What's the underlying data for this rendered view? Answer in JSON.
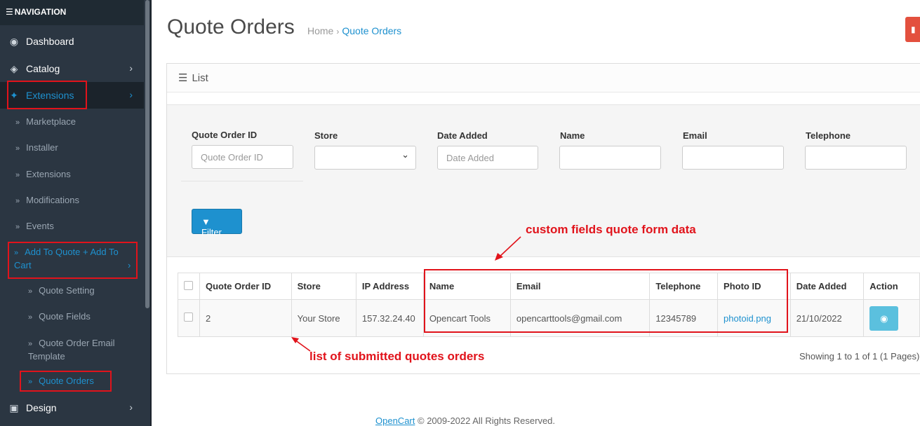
{
  "sidebar": {
    "header": "NAVIGATION",
    "items": [
      {
        "label": "Dashboard",
        "icon": "dashboard-icon"
      },
      {
        "label": "Catalog",
        "icon": "tags-icon"
      },
      {
        "label": "Extensions",
        "icon": "puzzle-icon"
      },
      {
        "label": "Design",
        "icon": "monitor-icon"
      }
    ],
    "extensions_sub": [
      "Marketplace",
      "Installer",
      "Extensions",
      "Modifications",
      "Events"
    ],
    "quote_group": "Add To Quote + Add To Cart",
    "quote_sub": [
      "Quote Setting",
      "Quote Fields",
      "Quote Order Email Template",
      "Quote Orders"
    ]
  },
  "header": {
    "title": "Quote Orders",
    "breadcrumb": [
      "Home",
      "Quote Orders"
    ]
  },
  "panel": {
    "title": "List"
  },
  "filters": {
    "quote_order_id": {
      "label": "Quote Order ID",
      "placeholder": "Quote Order ID"
    },
    "store": {
      "label": "Store",
      "value": ""
    },
    "date_added": {
      "label": "Date Added",
      "placeholder": "Date Added"
    },
    "name": {
      "label": "Name",
      "placeholder": ""
    },
    "email": {
      "label": "Email",
      "placeholder": ""
    },
    "telephone": {
      "label": "Telephone",
      "placeholder": ""
    },
    "button": "Filter"
  },
  "table": {
    "columns": [
      "Quote Order ID",
      "Store",
      "IP Address",
      "Name",
      "Email",
      "Telephone",
      "Photo ID",
      "Date Added",
      "Action"
    ],
    "rows": [
      {
        "id": "2",
        "store": "Your Store",
        "ip": "157.32.24.40",
        "name": "Opencart Tools",
        "email": "opencarttools@gmail.com",
        "telephone": "12345789",
        "photo": "photoid.png",
        "date": "21/10/2022"
      }
    ]
  },
  "pagination": "Showing 1 to 1 of 1 (1 Pages)",
  "annotations": {
    "custom_fields": "custom fields quote form data",
    "list": "list of submitted quotes orders"
  },
  "footer": {
    "link": "OpenCart",
    "text": "© 2009-2022 All Rights Reserved."
  },
  "colors": {
    "accent": "#1e91cf",
    "sidebar": "#2b3642",
    "annotation": "#e1131b",
    "delete": "#e3503e",
    "view": "#5bc0de"
  }
}
